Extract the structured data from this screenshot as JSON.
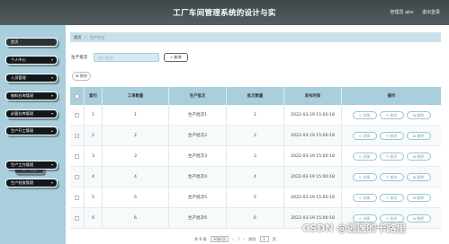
{
  "app": {
    "title": "工厂车间管理系统的设计与实",
    "user_label": "管理员 abo",
    "logout": "退出登录"
  },
  "sidebar": {
    "items": [
      {
        "label": "首页"
      },
      {
        "label": "个人中心"
      },
      {
        "label": "人员管理"
      },
      {
        "label": "物料仓库管理"
      },
      {
        "label": "必要仓库管理"
      },
      {
        "label": "生产开工管理"
      },
      {
        "label": "生产工作管理"
      },
      {
        "label": "生产检查管理"
      }
    ],
    "sub_item": "生产开工"
  },
  "breadcrumb": {
    "home": "首页",
    "sep": "/",
    "current": "生产开工"
  },
  "search": {
    "label": "生产批次",
    "placeholder": "生产批次",
    "button": "查询"
  },
  "delete_button": "删除",
  "table": {
    "headers": [
      "索引",
      "工单数量",
      "生产批次",
      "批次数量",
      "发布时间",
      "操作"
    ],
    "actions": [
      "详情",
      "修改",
      "删除"
    ],
    "rows": [
      {
        "index": "1",
        "qty": "1",
        "batch": "生产批次1",
        "batch_qty": "1",
        "time": "2022-03-19 15:00:18"
      },
      {
        "index": "2",
        "qty": "2",
        "batch": "生产批次2",
        "batch_qty": "2",
        "time": "2022-03-19 15:00:18"
      },
      {
        "index": "3",
        "qty": "3",
        "batch": "生产批次3",
        "batch_qty": "3",
        "time": "2022-03-19 15:00:18"
      },
      {
        "index": "4",
        "qty": "4",
        "batch": "生产批次4",
        "batch_qty": "4",
        "time": "2022-03-19 15:00:18"
      },
      {
        "index": "5",
        "qty": "5",
        "batch": "生产批次5",
        "batch_qty": "5",
        "time": "2022-03-19 15:00:18"
      },
      {
        "index": "6",
        "qty": "6",
        "batch": "生产批次6",
        "batch_qty": "6",
        "time": "2022-03-19 15:00:18"
      }
    ]
  },
  "pagination": {
    "total": "共 6 条",
    "page_size": "10条/页",
    "prev": "‹",
    "page": "1",
    "next": "›",
    "goto": "前往",
    "goto_value": "1",
    "page_suffix": "页"
  },
  "watermark": "CSDN @逃逸的卡路里",
  "colors": {
    "topbar": "#454e50",
    "sidebar": "#a9cfde",
    "table_header": "#a9cfde",
    "button_border": "#9bc3d6"
  }
}
